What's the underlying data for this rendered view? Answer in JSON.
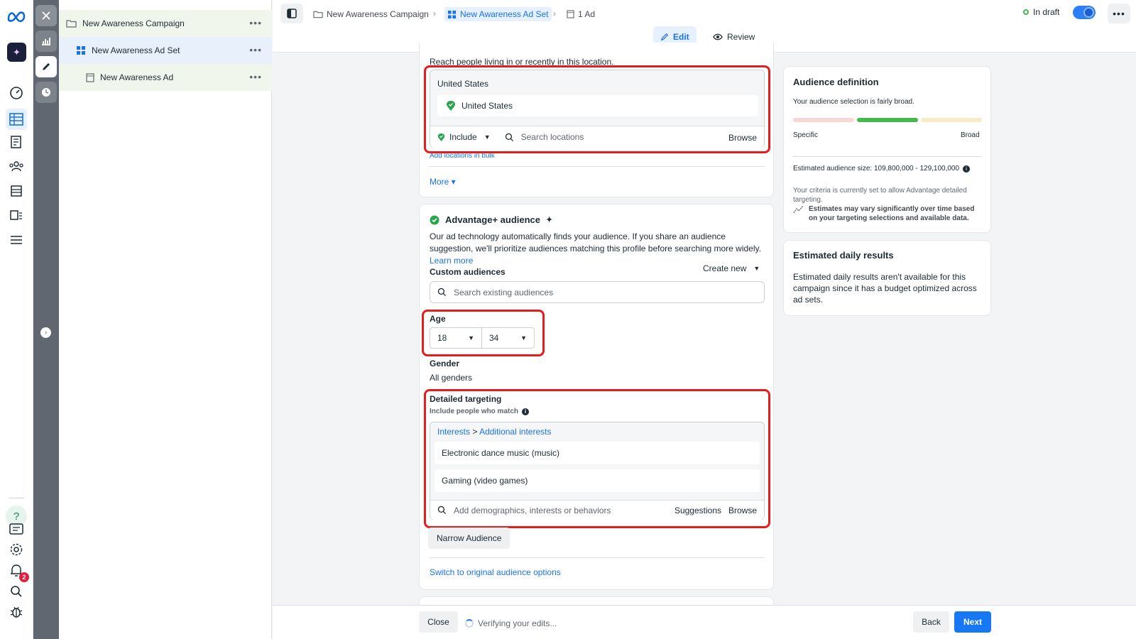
{
  "tree": {
    "campaign": "New Awareness Campaign",
    "adset": "New Awareness Ad Set",
    "ad": "New Awareness Ad",
    "more": "•••"
  },
  "breadcrumb": {
    "campaign": "New Awareness Campaign",
    "adset": "New Awareness Ad Set",
    "ad": "1 Ad"
  },
  "header": {
    "status": "In draft",
    "more": "•••",
    "tabs": {
      "edit": "Edit",
      "review": "Review"
    }
  },
  "location": {
    "reach_text": "Reach people living in or recently in this location.",
    "country_title": "United States",
    "selected": "United States",
    "include_label": "Include",
    "search_placeholder": "Search locations",
    "browse": "Browse",
    "bulk_link": "Add locations in bulk",
    "more_link": "More ▾"
  },
  "audience": {
    "title": "Advantage+ audience",
    "description": "Our ad technology automatically finds your audience. If you share an audience suggestion, we'll prioritize audiences matching this profile before searching more widely.",
    "learn_more": "Learn more",
    "custom_label": "Custom audiences",
    "create_new": "Create new",
    "custom_placeholder": "Search existing audiences",
    "age_label": "Age",
    "age_min": "18",
    "age_max": "34",
    "gender_label": "Gender",
    "gender_value": "All genders",
    "detailed_label": "Detailed targeting",
    "detailed_sub": "Include people who match",
    "path_interests": "Interests",
    "path_sep": ">",
    "path_additional": "Additional interests",
    "interests": [
      "Electronic dance music (music)",
      "Gaming (video games)"
    ],
    "dt_placeholder": "Add demographics, interests or behaviors",
    "suggestions": "Suggestions",
    "browse": "Browse",
    "narrow": "Narrow Audience",
    "switch_link": "Switch to original audience options"
  },
  "definition": {
    "title": "Audience definition",
    "broad_text": "Your audience selection is fairly broad.",
    "specific": "Specific",
    "broad": "Broad",
    "size_text": "Estimated audience size: 109,800,000 - 129,100,000",
    "criteria_text": "Your criteria is currently set to allow Advantage detailed targeting.",
    "estimates_text": "Estimates may vary significantly over time based on your targeting selections and available data."
  },
  "daily": {
    "title": "Estimated daily results",
    "text": "Estimated daily results aren't available for this campaign since it has a budget optimized across ad sets."
  },
  "footer": {
    "close": "Close",
    "verifying": "Verifying your edits...",
    "back": "Back",
    "next": "Next"
  },
  "notifications": {
    "count": "2"
  },
  "colors": {
    "accent": "#1877f2",
    "highlight_border": "#e41e1e",
    "meter_active": "#45b84e"
  }
}
